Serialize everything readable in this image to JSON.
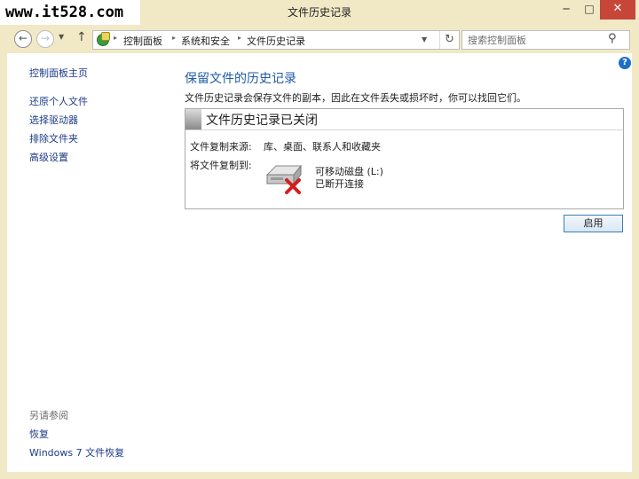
{
  "watermark": "www.it528.com",
  "window": {
    "title": "文件历史记录",
    "minimize": "─",
    "maximize": "□",
    "close": "✕"
  },
  "nav": {
    "back": "←",
    "forward": "→",
    "recent": "▼",
    "up": "↑",
    "breadcrumbs": [
      "控制面板",
      "系统和安全",
      "文件历史记录"
    ],
    "crumb_sep": "▸",
    "dropdown": "▼",
    "refresh": "↻"
  },
  "search": {
    "placeholder": "搜索控制面板",
    "icon": "⚲"
  },
  "sidebar": {
    "home": "控制面板主页",
    "items": [
      "还原个人文件",
      "选择驱动器",
      "排除文件夹",
      "高级设置"
    ],
    "see_also": {
      "heading": "另请参阅",
      "links": [
        "恢复",
        "Windows 7 文件恢复"
      ]
    }
  },
  "main": {
    "help": "?",
    "title": "保留文件的历史记录",
    "description": "文件历史记录会保存文件的副本，因此在文件丢失或损坏时，你可以找回它们。",
    "panel": {
      "title": "文件历史记录已关闭",
      "source_label": "文件复制来源:",
      "source_value": "库、桌面、联系人和收藏夹",
      "target_label": "将文件复制到:",
      "drive_name": "可移动磁盘 (L:)",
      "drive_status": "已断开连接"
    },
    "enable_button": "启用"
  },
  "colors": {
    "frame": "#f1e9c6",
    "link": "#1c3a87",
    "heading": "#1e5aa8",
    "close_button": "#c7463a",
    "error_x": "#d21f1f"
  }
}
